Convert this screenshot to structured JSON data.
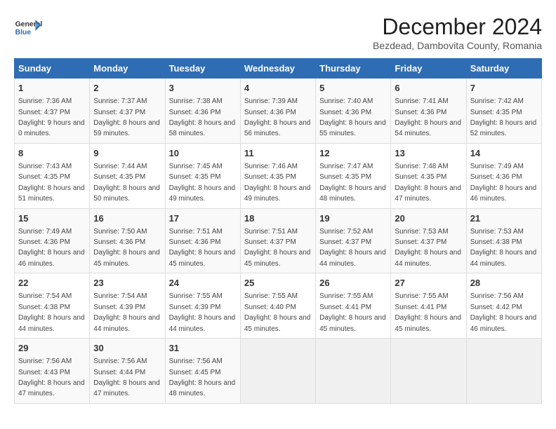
{
  "header": {
    "logo_line1": "General",
    "logo_line2": "Blue",
    "title": "December 2024",
    "subtitle": "Bezdead, Dambovita County, Romania"
  },
  "weekdays": [
    "Sunday",
    "Monday",
    "Tuesday",
    "Wednesday",
    "Thursday",
    "Friday",
    "Saturday"
  ],
  "weeks": [
    [
      {
        "day": "1",
        "sunrise": "7:36 AM",
        "sunset": "4:37 PM",
        "daylight": "9 hours and 0 minutes."
      },
      {
        "day": "2",
        "sunrise": "7:37 AM",
        "sunset": "4:37 PM",
        "daylight": "8 hours and 59 minutes."
      },
      {
        "day": "3",
        "sunrise": "7:38 AM",
        "sunset": "4:36 PM",
        "daylight": "8 hours and 58 minutes."
      },
      {
        "day": "4",
        "sunrise": "7:39 AM",
        "sunset": "4:36 PM",
        "daylight": "8 hours and 56 minutes."
      },
      {
        "day": "5",
        "sunrise": "7:40 AM",
        "sunset": "4:36 PM",
        "daylight": "8 hours and 55 minutes."
      },
      {
        "day": "6",
        "sunrise": "7:41 AM",
        "sunset": "4:36 PM",
        "daylight": "8 hours and 54 minutes."
      },
      {
        "day": "7",
        "sunrise": "7:42 AM",
        "sunset": "4:35 PM",
        "daylight": "8 hours and 52 minutes."
      }
    ],
    [
      {
        "day": "8",
        "sunrise": "7:43 AM",
        "sunset": "4:35 PM",
        "daylight": "8 hours and 51 minutes."
      },
      {
        "day": "9",
        "sunrise": "7:44 AM",
        "sunset": "4:35 PM",
        "daylight": "8 hours and 50 minutes."
      },
      {
        "day": "10",
        "sunrise": "7:45 AM",
        "sunset": "4:35 PM",
        "daylight": "8 hours and 49 minutes."
      },
      {
        "day": "11",
        "sunrise": "7:46 AM",
        "sunset": "4:35 PM",
        "daylight": "8 hours and 49 minutes."
      },
      {
        "day": "12",
        "sunrise": "7:47 AM",
        "sunset": "4:35 PM",
        "daylight": "8 hours and 48 minutes."
      },
      {
        "day": "13",
        "sunrise": "7:48 AM",
        "sunset": "4:35 PM",
        "daylight": "8 hours and 47 minutes."
      },
      {
        "day": "14",
        "sunrise": "7:49 AM",
        "sunset": "4:36 PM",
        "daylight": "8 hours and 46 minutes."
      }
    ],
    [
      {
        "day": "15",
        "sunrise": "7:49 AM",
        "sunset": "4:36 PM",
        "daylight": "8 hours and 46 minutes."
      },
      {
        "day": "16",
        "sunrise": "7:50 AM",
        "sunset": "4:36 PM",
        "daylight": "8 hours and 45 minutes."
      },
      {
        "day": "17",
        "sunrise": "7:51 AM",
        "sunset": "4:36 PM",
        "daylight": "8 hours and 45 minutes."
      },
      {
        "day": "18",
        "sunrise": "7:51 AM",
        "sunset": "4:37 PM",
        "daylight": "8 hours and 45 minutes."
      },
      {
        "day": "19",
        "sunrise": "7:52 AM",
        "sunset": "4:37 PM",
        "daylight": "8 hours and 44 minutes."
      },
      {
        "day": "20",
        "sunrise": "7:53 AM",
        "sunset": "4:37 PM",
        "daylight": "8 hours and 44 minutes."
      },
      {
        "day": "21",
        "sunrise": "7:53 AM",
        "sunset": "4:38 PM",
        "daylight": "8 hours and 44 minutes."
      }
    ],
    [
      {
        "day": "22",
        "sunrise": "7:54 AM",
        "sunset": "4:38 PM",
        "daylight": "8 hours and 44 minutes."
      },
      {
        "day": "23",
        "sunrise": "7:54 AM",
        "sunset": "4:39 PM",
        "daylight": "8 hours and 44 minutes."
      },
      {
        "day": "24",
        "sunrise": "7:55 AM",
        "sunset": "4:39 PM",
        "daylight": "8 hours and 44 minutes."
      },
      {
        "day": "25",
        "sunrise": "7:55 AM",
        "sunset": "4:40 PM",
        "daylight": "8 hours and 45 minutes."
      },
      {
        "day": "26",
        "sunrise": "7:55 AM",
        "sunset": "4:41 PM",
        "daylight": "8 hours and 45 minutes."
      },
      {
        "day": "27",
        "sunrise": "7:55 AM",
        "sunset": "4:41 PM",
        "daylight": "8 hours and 45 minutes."
      },
      {
        "day": "28",
        "sunrise": "7:56 AM",
        "sunset": "4:42 PM",
        "daylight": "8 hours and 46 minutes."
      }
    ],
    [
      {
        "day": "29",
        "sunrise": "7:56 AM",
        "sunset": "4:43 PM",
        "daylight": "8 hours and 47 minutes."
      },
      {
        "day": "30",
        "sunrise": "7:56 AM",
        "sunset": "4:44 PM",
        "daylight": "8 hours and 47 minutes."
      },
      {
        "day": "31",
        "sunrise": "7:56 AM",
        "sunset": "4:45 PM",
        "daylight": "8 hours and 48 minutes."
      },
      null,
      null,
      null,
      null
    ]
  ]
}
